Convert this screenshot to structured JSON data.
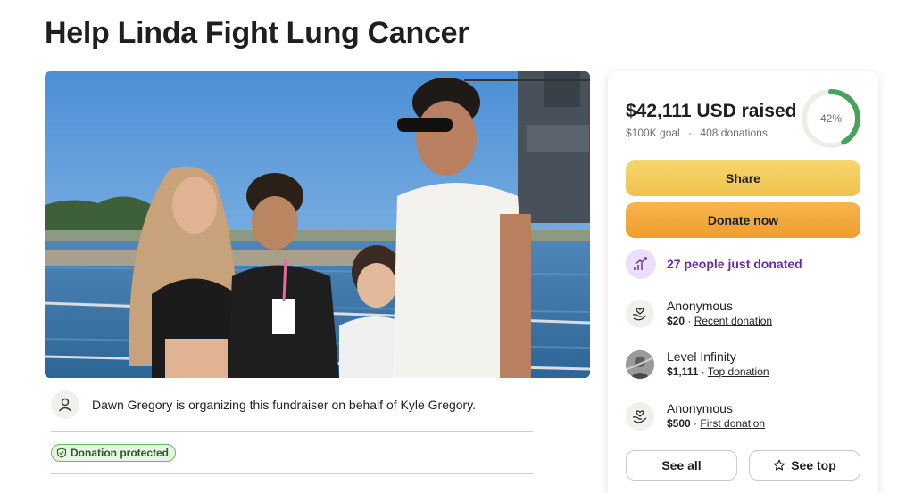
{
  "page": {
    "title": "Help Linda Fight Lung Cancer"
  },
  "organizer": {
    "text": "Dawn Gregory is organizing this fundraiser on behalf of Kyle Gregory.",
    "icon": "person-icon"
  },
  "badge": {
    "label": "Donation protected",
    "icon": "shield-check-icon"
  },
  "donation_card": {
    "raised": "$42,111 USD raised",
    "goal": "$100K goal",
    "separator": "·",
    "donations_count": "408 donations",
    "progress_percent": 42,
    "progress_label": "42%",
    "share_label": "Share",
    "donate_label": "Donate now",
    "recent_activity": "27 people just donated",
    "donations": [
      {
        "name": "Anonymous",
        "amount": "$20",
        "separator": " · ",
        "tag": "Recent donation",
        "icon": "heart-hands-icon"
      },
      {
        "name": "Level Infinity",
        "amount": "$1,111",
        "separator": " · ",
        "tag": "Top donation",
        "icon": "avatar-photo"
      },
      {
        "name": "Anonymous",
        "amount": "$500",
        "separator": " · ",
        "tag": "First donation",
        "icon": "heart-hands-icon"
      }
    ],
    "see_all_label": "See all",
    "see_top_label": "See top"
  },
  "colors": {
    "progress_ring": "#4aa35c",
    "share_button": "#f2c957",
    "donate_button": "#f1a63a",
    "recent_activity_text": "#6b2aa8",
    "badge_green": "#67b964"
  }
}
